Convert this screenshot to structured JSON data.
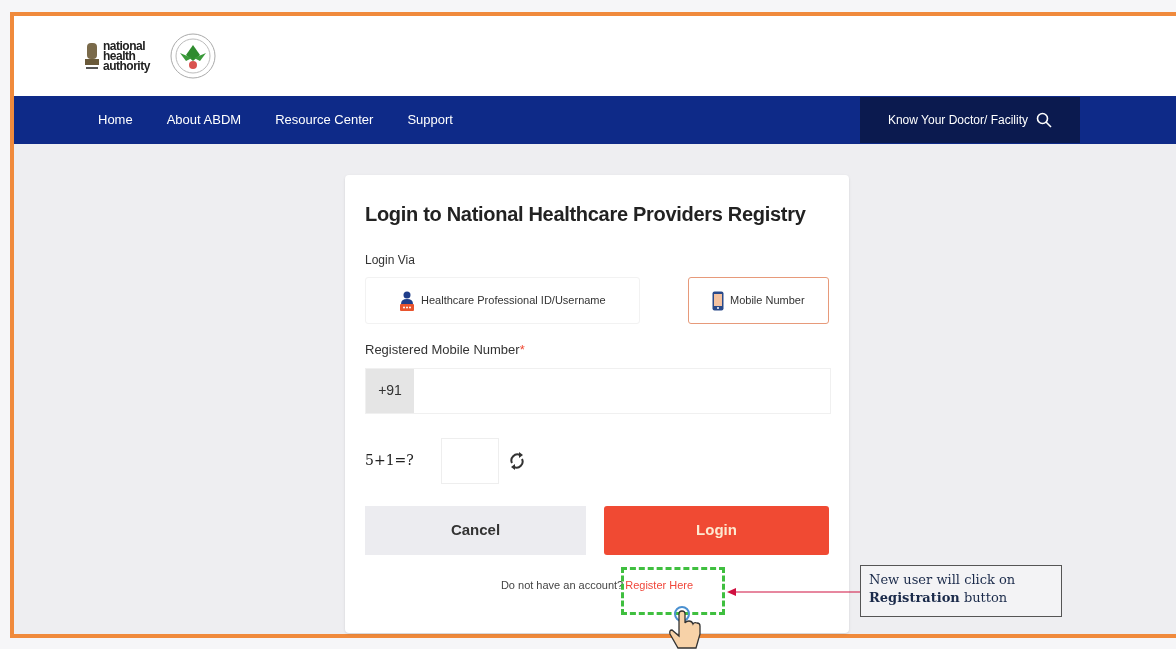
{
  "header": {
    "logo_lines": [
      "national",
      "health",
      "authority"
    ]
  },
  "nav": {
    "items": [
      {
        "label": "Home"
      },
      {
        "label": "About ABDM"
      },
      {
        "label": "Resource Center"
      },
      {
        "label": "Support"
      }
    ],
    "search_label": "Know Your Doctor/ Facility"
  },
  "login": {
    "title": "Login to National Healthcare Providers Registry",
    "via_label": "Login Via",
    "options": [
      {
        "label": "Healthcare Professional ID/Username",
        "kind": "person",
        "selected": false
      },
      {
        "label": "Mobile Number",
        "kind": "phone",
        "selected": true
      }
    ],
    "mobile_label": "Registered Mobile Number",
    "required_mark": "*",
    "country_code": "+91",
    "captcha": "5+1=?",
    "cancel": "Cancel",
    "submit": "Login",
    "register_prompt": "Do not have an account?",
    "register_link": "Register Here"
  },
  "annotation": {
    "text": "New user will click on **Registration** button"
  }
}
